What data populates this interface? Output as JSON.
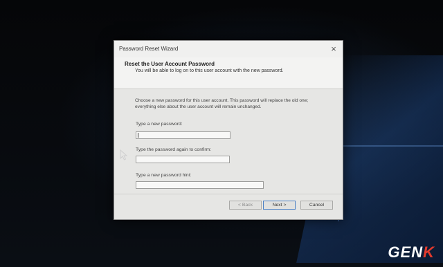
{
  "window": {
    "title": "Password Reset Wizard",
    "close_glyph": "×"
  },
  "header": {
    "title": "Reset the User Account Password",
    "subtitle": "You will be able to log on to this user account with the new password."
  },
  "body": {
    "description": "Choose a new password for this user account. This password will replace the old one; everything else about the user account will remain unchanged.",
    "fields": [
      {
        "label": "Type a new password:",
        "value": ""
      },
      {
        "label": "Type the password again to confirm:",
        "value": ""
      },
      {
        "label": "Type a new password hint:",
        "value": ""
      }
    ]
  },
  "buttons": {
    "back": "< Back",
    "next": "Next >",
    "cancel": "Cancel"
  },
  "watermark": {
    "text_main": "GEN",
    "text_accent": "K"
  },
  "colors": {
    "dialog_bg": "#e6e6e4",
    "accent_border": "#4a7fc4",
    "watermark_accent": "#e23a2d"
  }
}
